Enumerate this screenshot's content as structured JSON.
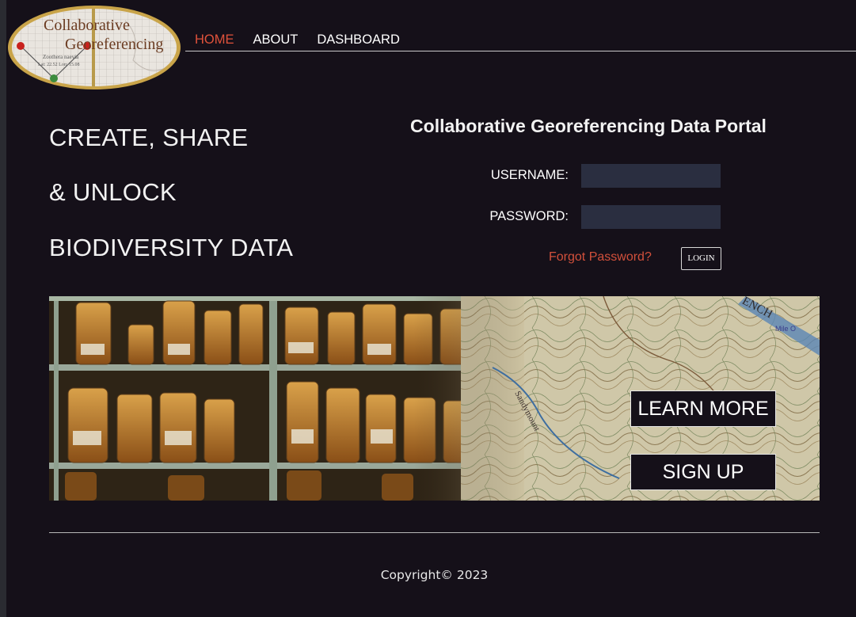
{
  "logo": {
    "line1": "Collaborative",
    "line2": "Georeferencing",
    "specimen": "Zoothera naevia",
    "coords": "Lat: 22.52 Lon: 15.08"
  },
  "nav": {
    "items": [
      {
        "label": "HOME",
        "active": true
      },
      {
        "label": "ABOUT",
        "active": false
      },
      {
        "label": "DASHBOARD",
        "active": false
      }
    ]
  },
  "hero": {
    "line1": "CREATE, SHARE",
    "line2": "& UNLOCK",
    "line3": "BIODIVERSITY DATA"
  },
  "login": {
    "title": "Collaborative Georeferencing Data Portal",
    "username_label": "USERNAME:",
    "username_value": "",
    "password_label": "PASSWORD:",
    "password_value": "",
    "forgot_label": "Forgot Password?",
    "login_label": "LOGIN"
  },
  "banner": {
    "map_labels": [
      "ENCH",
      "Mile O",
      "Sandymount"
    ],
    "learn_more_label": "LEARN MORE",
    "sign_up_label": "SIGN UP"
  },
  "footer": {
    "copyright": "Copyright© 2023"
  },
  "colors": {
    "background": "#151019",
    "accent": "#e0523b",
    "input_bg": "#2a2e40",
    "logo_ring": "#c9a449"
  }
}
